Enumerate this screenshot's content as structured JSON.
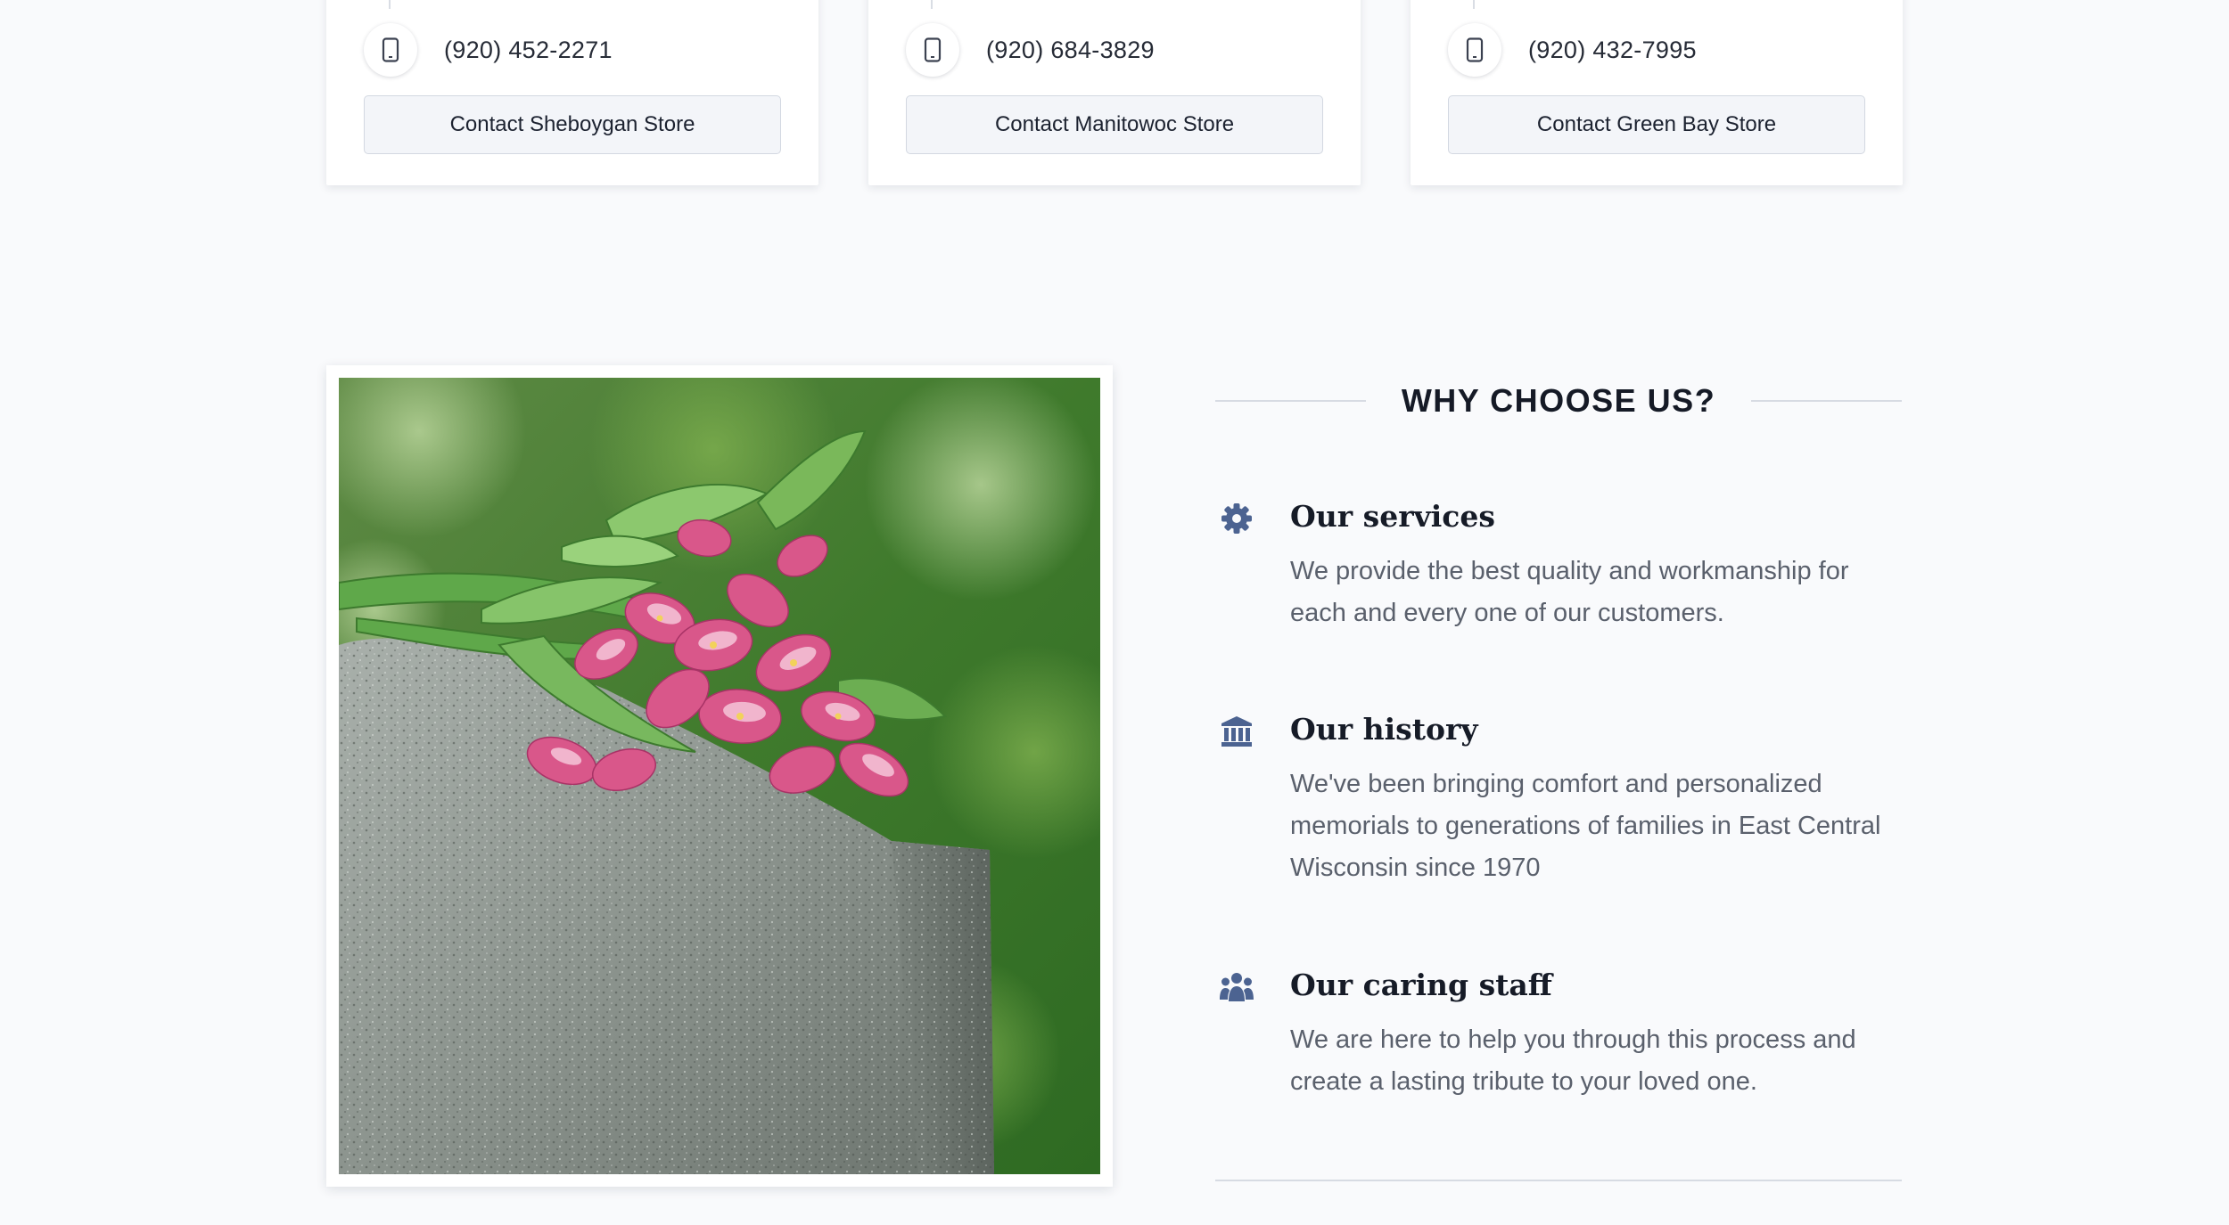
{
  "stores": [
    {
      "phone": "(920) 452-2271",
      "button_label": "Contact Sheboygan Store"
    },
    {
      "phone": "(920) 684-3829",
      "button_label": "Contact Manitowoc Store"
    },
    {
      "phone": "(920) 432-7995",
      "button_label": "Contact Green Bay Store"
    }
  ],
  "photo": {
    "subject": "pink lilies on granite headstone"
  },
  "why": {
    "title": "WHY CHOOSE US?",
    "features": [
      {
        "icon": "gear-icon",
        "title": "Our services",
        "description": "We provide the best quality and workmanship for each and every one of our customers."
      },
      {
        "icon": "museum-icon",
        "title": "Our history",
        "description": "We've been bringing comfort and personalized memorials to generations of families in East Central Wisconsin since 1970"
      },
      {
        "icon": "people-icon",
        "title": "Our caring staff",
        "description": "We are here to help you through this process and create a lasting tribute to your loved one."
      }
    ]
  },
  "colors": {
    "page_background": "#f9fafc",
    "icon_accent": "#4c6391",
    "button_background": "#f3f5f9"
  }
}
